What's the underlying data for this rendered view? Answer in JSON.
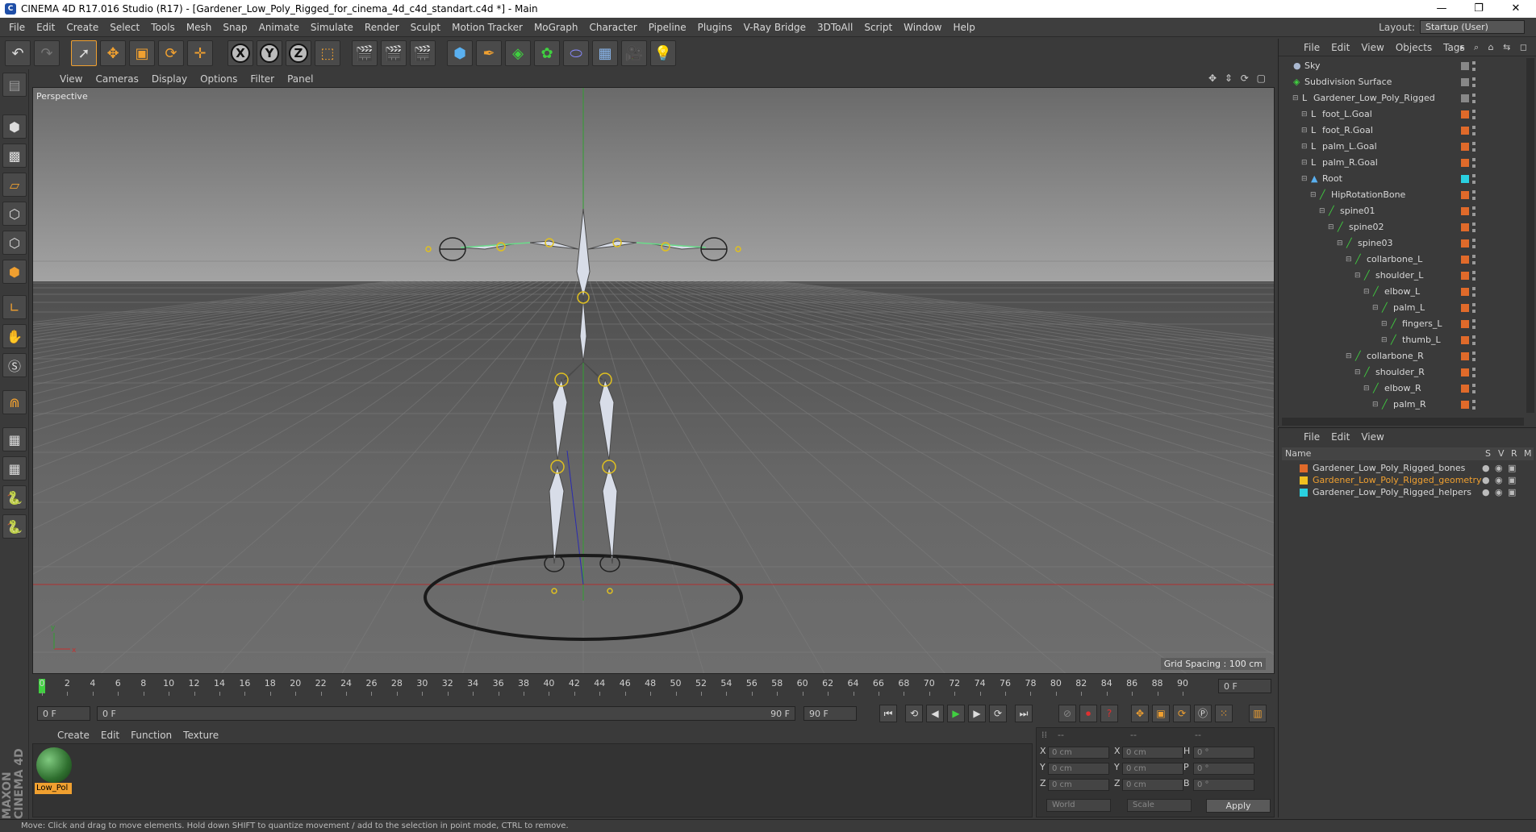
{
  "window": {
    "title": "CINEMA 4D R17.016 Studio (R17) - [Gardener_Low_Poly_Rigged_for_cinema_4d_c4d_standart.c4d *] - Main",
    "minimize": "—",
    "restore": "❐",
    "close": "✕"
  },
  "menu": [
    "File",
    "Edit",
    "Create",
    "Select",
    "Tools",
    "Mesh",
    "Snap",
    "Animate",
    "Simulate",
    "Render",
    "Sculpt",
    "Motion Tracker",
    "MoGraph",
    "Character",
    "Pipeline",
    "Plugins",
    "V-Ray Bridge",
    "3DToAll",
    "Script",
    "Window",
    "Help"
  ],
  "layout": {
    "label": "Layout:",
    "value": "Startup (User)"
  },
  "viewport": {
    "menu": [
      "View",
      "Cameras",
      "Display",
      "Options",
      "Filter",
      "Panel"
    ],
    "label": "Perspective",
    "grid_spacing": "Grid Spacing : 100 cm",
    "nav_icons": "✥ ⇕ ⟳ ▢"
  },
  "timeline": {
    "ticks": [
      "0",
      "2",
      "4",
      "6",
      "8",
      "10",
      "12",
      "14",
      "16",
      "18",
      "20",
      "22",
      "24",
      "26",
      "28",
      "30",
      "32",
      "34",
      "36",
      "38",
      "40",
      "42",
      "44",
      "46",
      "48",
      "50",
      "52",
      "54",
      "56",
      "58",
      "60",
      "62",
      "64",
      "66",
      "68",
      "70",
      "72",
      "74",
      "76",
      "78",
      "80",
      "82",
      "84",
      "86",
      "88",
      "90"
    ],
    "end_field": "0 F"
  },
  "playbar": {
    "current": "0 F",
    "range_start": "0 F",
    "range_end": "90 F",
    "end": "90 F"
  },
  "material": {
    "menu": [
      "Create",
      "Edit",
      "Function",
      "Texture"
    ],
    "items": [
      {
        "name": "Low_Pol"
      }
    ]
  },
  "coords": {
    "headers": [
      "--",
      "--",
      "--"
    ],
    "rows": [
      {
        "a": "X",
        "av": "0 cm",
        "b": "X",
        "bv": "0 cm",
        "c": "H",
        "cv": "0 °"
      },
      {
        "a": "Y",
        "av": "0 cm",
        "b": "Y",
        "bv": "0 cm",
        "c": "P",
        "cv": "0 °"
      },
      {
        "a": "Z",
        "av": "0 cm",
        "b": "Z",
        "bv": "0 cm",
        "c": "B",
        "cv": "0 °"
      }
    ],
    "mode1": "World",
    "mode2": "Scale",
    "apply": "Apply"
  },
  "status": "Move: Click and drag to move elements. Hold down SHIFT to quantize movement / add to the selection in point mode, CTRL to remove.",
  "objects": {
    "menu": [
      "File",
      "Edit",
      "View",
      "Objects",
      "Tags"
    ],
    "rows": [
      {
        "name": "Sky",
        "depth": 0,
        "tag": "#888888",
        "type": "sky"
      },
      {
        "name": "Subdivision Surface",
        "depth": 0,
        "tag": "#888888",
        "type": "subd"
      },
      {
        "name": "Gardener_Low_Poly_Rigged",
        "depth": 1,
        "tag": "#888888",
        "type": "null"
      },
      {
        "name": "foot_L.Goal",
        "depth": 2,
        "tag": "#e06a2a",
        "type": "null"
      },
      {
        "name": "foot_R.Goal",
        "depth": 2,
        "tag": "#e06a2a",
        "type": "null"
      },
      {
        "name": "palm_L.Goal",
        "depth": 2,
        "tag": "#e06a2a",
        "type": "null"
      },
      {
        "name": "palm_R.Goal",
        "depth": 2,
        "tag": "#e06a2a",
        "type": "null"
      },
      {
        "name": "Root",
        "depth": 2,
        "tag": "#2ad0e0",
        "type": "root"
      },
      {
        "name": "HipRotationBone",
        "depth": 3,
        "tag": "#e06a2a",
        "type": "bone"
      },
      {
        "name": "spine01",
        "depth": 4,
        "tag": "#e06a2a",
        "type": "bone"
      },
      {
        "name": "spine02",
        "depth": 5,
        "tag": "#e06a2a",
        "type": "bone"
      },
      {
        "name": "spine03",
        "depth": 6,
        "tag": "#e06a2a",
        "type": "bone"
      },
      {
        "name": "collarbone_L",
        "depth": 7,
        "tag": "#e06a2a",
        "type": "bone"
      },
      {
        "name": "shoulder_L",
        "depth": 8,
        "tag": "#e06a2a",
        "type": "bone"
      },
      {
        "name": "elbow_L",
        "depth": 9,
        "tag": "#e06a2a",
        "type": "bone"
      },
      {
        "name": "palm_L",
        "depth": 10,
        "tag": "#e06a2a",
        "type": "bone"
      },
      {
        "name": "fingers_L",
        "depth": 11,
        "tag": "#e06a2a",
        "type": "bone"
      },
      {
        "name": "thumb_L",
        "depth": 11,
        "tag": "#e06a2a",
        "type": "bone"
      },
      {
        "name": "collarbone_R",
        "depth": 7,
        "tag": "#e06a2a",
        "type": "bone"
      },
      {
        "name": "shoulder_R",
        "depth": 8,
        "tag": "#e06a2a",
        "type": "bone"
      },
      {
        "name": "elbow_R",
        "depth": 9,
        "tag": "#e06a2a",
        "type": "bone"
      },
      {
        "name": "palm_R",
        "depth": 10,
        "tag": "#e06a2a",
        "type": "bone"
      }
    ]
  },
  "layers": {
    "menu": [
      "File",
      "Edit",
      "View"
    ],
    "header": {
      "name": "Name",
      "s": "S",
      "v": "V",
      "r": "R",
      "m": "M"
    },
    "rows": [
      {
        "name": "Gardener_Low_Poly_Rigged_bones",
        "color": "#e06a2a",
        "text": "#d8d8d8"
      },
      {
        "name": "Gardener_Low_Poly_Rigged_geometry",
        "color": "#f0c020",
        "text": "#f0a030"
      },
      {
        "name": "Gardener_Low_Poly_Rigged_helpers",
        "color": "#2ad0e0",
        "text": "#d8d8d8"
      }
    ]
  },
  "colors": {
    "accent": "#f0a030",
    "panel": "#3a3a3a",
    "x_axis": "#c83030",
    "y_axis": "#30a030"
  }
}
